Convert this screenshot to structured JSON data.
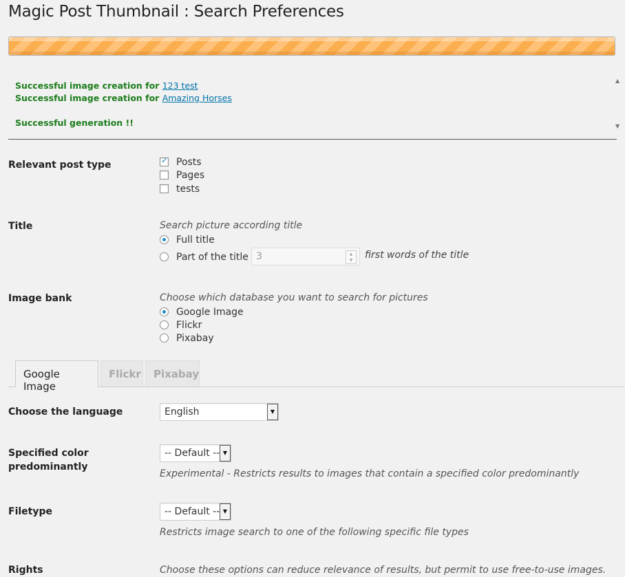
{
  "page": {
    "title": "Magic Post Thumbnail : Search Preferences"
  },
  "progress": {
    "percent": 100,
    "color": "#fbae4e"
  },
  "log": {
    "line1_prefix": "Successful image creation for ",
    "line1_link": "123 test",
    "line2_prefix": "Successful image creation for ",
    "line2_link": "Amazing Horses",
    "line3": "Successful generation !!"
  },
  "post_type": {
    "label": "Relevant post type",
    "options": [
      {
        "label": "Posts",
        "checked": true
      },
      {
        "label": "Pages",
        "checked": false
      },
      {
        "label": "tests",
        "checked": false
      }
    ]
  },
  "title": {
    "label": "Title",
    "hint": "Search picture according title",
    "full_title": "Full title",
    "part_title": "Part of the title :",
    "words_value": "3",
    "words_suffix": "first words of the title"
  },
  "image_bank": {
    "label": "Image bank",
    "hint": "Choose which database you want to search for pictures",
    "options": [
      "Google Image",
      "Flickr",
      "Pixabay"
    ],
    "selected": "Google Image"
  },
  "tabs": [
    "Google Image",
    "Flickr",
    "Pixabay"
  ],
  "google": {
    "language_label": "Choose the language",
    "language_value": "English",
    "color_label_1": "Specified color",
    "color_label_2": "predominantly",
    "color_value": "-- Default --",
    "color_hint": "Experimental - Restricts results to images that contain a specified color predominantly",
    "filetype_label": "Filetype",
    "filetype_value": "-- Default --",
    "filetype_hint": "Restricts image search to one of the following specific file types",
    "rights_label": "Rights",
    "rights_hint": "Choose these options can reduce relevance of results, but permit to use free-to-use images."
  }
}
